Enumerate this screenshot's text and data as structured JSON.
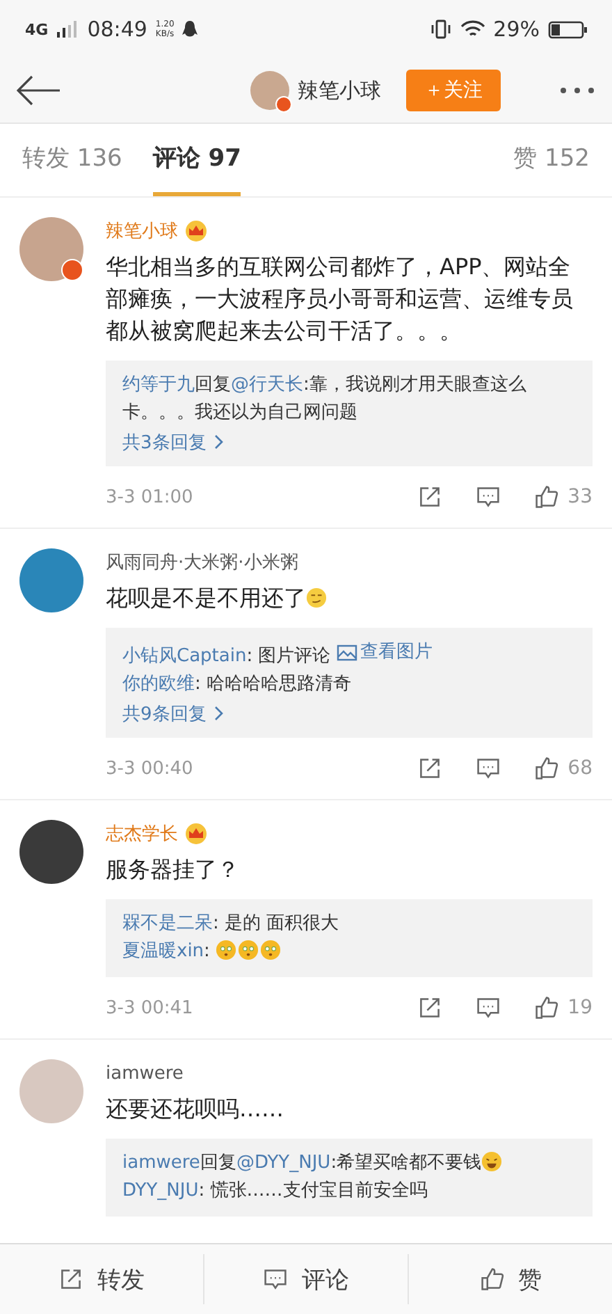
{
  "status_bar": {
    "network": "4G",
    "time": "08:49",
    "speed": "1.20",
    "speed_unit": "KB/s",
    "battery": "29%"
  },
  "header": {
    "title": "辣笔小球",
    "verified": true,
    "follow_button": "＋关注"
  },
  "tabs": [
    {
      "label": "转发 136",
      "selected": false
    },
    {
      "label": "评论 97",
      "selected": true
    },
    {
      "label": "赞 152",
      "selected": false
    }
  ],
  "comments": [
    {
      "name": "辣笔小球",
      "vip": true,
      "verified": true,
      "text": "华北相当多的互联网公司都炸了，APP、网站全部瘫痪，一大波程序员小哥哥和运营、运维专员都从被窝爬起来去公司干活了。。。",
      "text_emoji": false,
      "replies": [
        {
          "name": "约等于九",
          "action": "回复",
          "mention": "@行天长",
          "text": ":靠，我说刚才用天眼查这么卡。。。我还以为自己网问题"
        }
      ],
      "more": "共3条回复",
      "time": "3-3 01:00",
      "likes": "33"
    },
    {
      "name": "风雨同舟·大米粥·小米粥",
      "vip": false,
      "verified": false,
      "text": "花呗是不是不用还了",
      "text_emoji": true,
      "replies": [
        {
          "name": "小钻风Captain",
          "text": ": 图片评论 ",
          "link": "查看图片"
        },
        {
          "name": "你的欧维",
          "text": ": 哈哈哈哈思路清奇"
        }
      ],
      "more": "共9条回复",
      "time": "3-3 00:40",
      "likes": "68"
    },
    {
      "name": "志杰学长",
      "vip": true,
      "verified": false,
      "text": "服务器挂了？",
      "text_emoji": false,
      "replies": [
        {
          "name": "槑不是二呆",
          "text": ": 是的 面积很大"
        },
        {
          "name": "夏温暖xin",
          "text": ": ",
          "emojis": [
            {
              "kind": "dizzy"
            },
            {
              "kind": "dizzy"
            },
            {
              "kind": "dizzy"
            }
          ]
        }
      ],
      "time": "3-3 00:41",
      "likes": "19"
    },
    {
      "name": "iamwere",
      "vip": false,
      "verified": false,
      "text": "还要还花呗吗……",
      "text_emoji": false,
      "replies": [
        {
          "name": "iamwere",
          "action": "回复",
          "mention": "@DYY_NJU",
          "text": ":希望买啥都不要钱",
          "emojis": [
            {
              "kind": "laugh"
            }
          ]
        },
        {
          "name": "DYY_NJU",
          "text": ": 慌张……支付宝目前安全吗"
        }
      ]
    }
  ],
  "bottom_bar": [
    {
      "kind": "repost",
      "label": "转发"
    },
    {
      "kind": "comment",
      "label": "评论"
    },
    {
      "kind": "like",
      "label": "赞"
    }
  ]
}
